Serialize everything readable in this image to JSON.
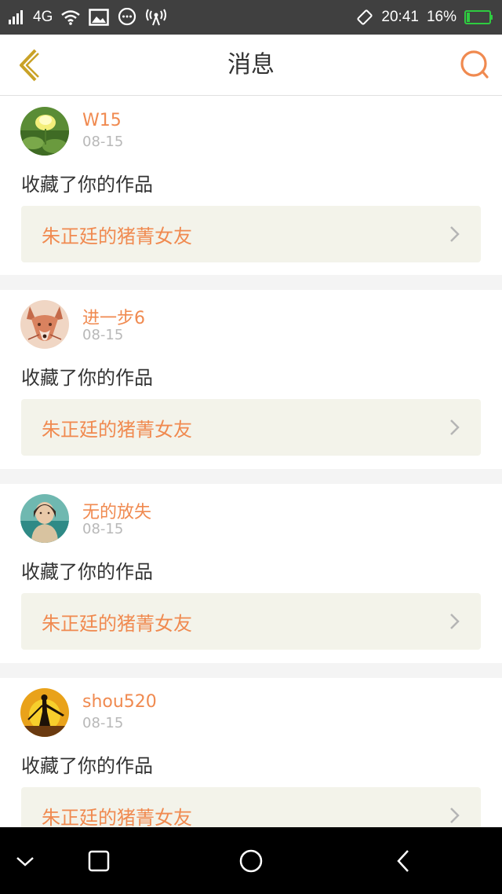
{
  "status_bar": {
    "network": "4G",
    "time": "20:41",
    "battery": "16%",
    "battery_level": 0.16,
    "battery_color": "#2ecc40"
  },
  "header": {
    "title": "消息",
    "accent_color": "#f08a50",
    "back_color": "#c9a227"
  },
  "messages": [
    {
      "user": "W15",
      "date": "08-15",
      "action": "收藏了你的作品",
      "work_title": "朱正廷的猪菁女友",
      "avatar": "lotus-flower"
    },
    {
      "user": "进一步6",
      "date": "08-15",
      "action": "收藏了你的作品",
      "work_title": "朱正廷的猪菁女友",
      "avatar": "fox-illustration"
    },
    {
      "user": "无的放失",
      "date": "08-15",
      "action": "收藏了你的作品",
      "work_title": "朱正廷的猪菁女友",
      "avatar": "portrait"
    },
    {
      "user": "shou520",
      "date": "08-15",
      "action": "收藏了你的作品",
      "work_title": "朱正廷的猪菁女友",
      "avatar": "sunset-silhouette"
    }
  ]
}
